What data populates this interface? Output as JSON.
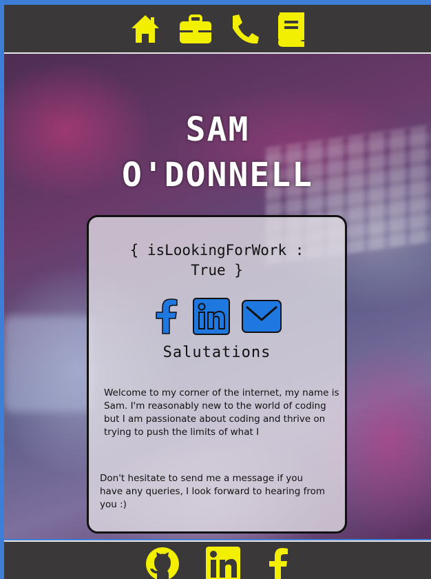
{
  "colors": {
    "accent": "#f2f000",
    "bar": "#3a3838",
    "link_blue": "#1e78e0"
  },
  "nav": {
    "items": [
      {
        "icon": "home-icon"
      },
      {
        "icon": "briefcase-icon"
      },
      {
        "icon": "phone-icon"
      },
      {
        "icon": "book-icon"
      }
    ]
  },
  "hero": {
    "name_line1": "SAM",
    "name_line2": "O'DONNELL"
  },
  "card": {
    "tag_line1": "{ isLookingForWork :",
    "tag_line2": "True }",
    "socials": [
      {
        "icon": "facebook-icon"
      },
      {
        "icon": "linkedin-icon"
      },
      {
        "icon": "email-icon"
      }
    ],
    "heading": "Salutations",
    "intro": "Welcome to my corner of the internet, my name is Sam.  I'm reasonably new to the world of coding but I am passionate about coding and thrive on trying to push the limits of what I",
    "contact": "Don't hesitate to send me a message if you have any queries, I look forward to hearing from you :)"
  },
  "footer": {
    "items": [
      {
        "icon": "github-icon"
      },
      {
        "icon": "linkedin-icon"
      },
      {
        "icon": "facebook-icon"
      }
    ]
  }
}
